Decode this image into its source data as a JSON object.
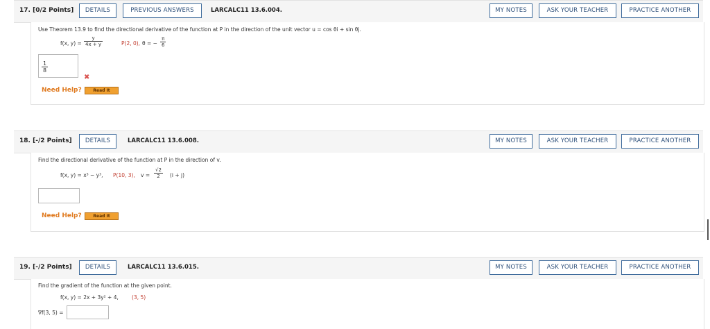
{
  "questions": [
    {
      "number": "17.",
      "points": "[0/2 Points]",
      "buttons": {
        "details": "DETAILS",
        "previous_answers": "PREVIOUS ANSWERS",
        "my_notes": "MY NOTES",
        "ask_teacher": "ASK YOUR TEACHER",
        "practice_another": "PRACTICE ANOTHER"
      },
      "code": "LARCALC11 13.6.004.",
      "prompt": "Use Theorem 13.9 to find the directional derivative of the function at P in the direction of the unit vector u = cos θi + sin θj.",
      "function_lhs": "f(x, y) =",
      "frac_num": "y",
      "frac_den": "4x + y",
      "point": "P(2, 0),",
      "theta": "θ = −",
      "theta_num": "π",
      "theta_den": "6",
      "answer_value": "1/8",
      "answer_num": "1",
      "answer_den": "8",
      "answer_status": "incorrect",
      "need_help": "Need Help?",
      "read_it": "Read It"
    },
    {
      "number": "18.",
      "points": "[-/2 Points]",
      "buttons": {
        "details": "DETAILS",
        "my_notes": "MY NOTES",
        "ask_teacher": "ASK YOUR TEACHER",
        "practice_another": "PRACTICE ANOTHER"
      },
      "code": "LARCALC11 13.6.008.",
      "prompt": "Find the directional derivative of the function at P in the direction of v.",
      "function": "f(x, y) = x³ − y³,",
      "point": "P(10, 3),",
      "v_lhs": "v =",
      "v_num": "√2",
      "v_den": "2",
      "v_rhs": "(i + j)",
      "answer_value": "",
      "need_help": "Need Help?",
      "read_it": "Read It"
    },
    {
      "number": "19.",
      "points": "[-/2 Points]",
      "buttons": {
        "details": "DETAILS",
        "my_notes": "MY NOTES",
        "ask_teacher": "ASK YOUR TEACHER",
        "practice_another": "PRACTICE ANOTHER"
      },
      "code": "LARCALC11 13.6.015.",
      "prompt": "Find the gradient of the function at the given point.",
      "function": "f(x, y) = 2x + 3y² + 4,",
      "point": "(3, 5)",
      "answer_label": "∇f(3, 5) =",
      "answer_value": ""
    }
  ],
  "colors": {
    "button_border": "#3d6a9b",
    "help_orange": "#e07b21",
    "read_it_bg": "#f0a030",
    "error_red": "#d9534f",
    "point_red": "#c0392b"
  }
}
